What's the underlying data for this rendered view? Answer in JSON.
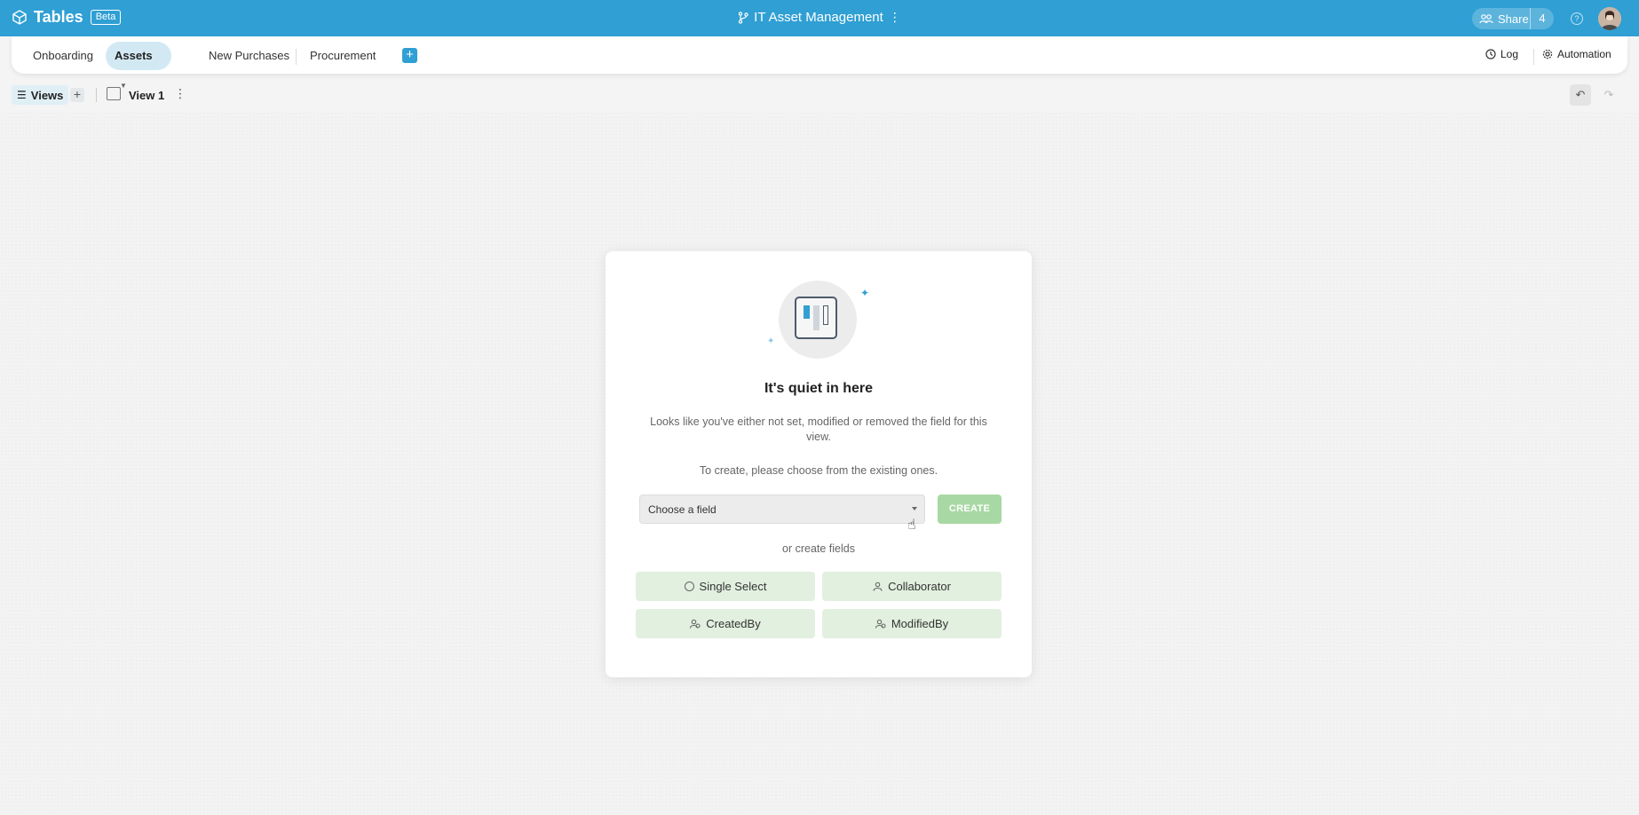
{
  "app": {
    "title": "Tables",
    "badge": "Beta"
  },
  "header": {
    "document_title": "IT Asset Management",
    "share_label": "Share",
    "share_count": "4"
  },
  "tabs": [
    {
      "label": "Onboarding"
    },
    {
      "label": "Assets",
      "active": true
    },
    {
      "label": "New Purchases"
    },
    {
      "label": "Procurement"
    }
  ],
  "tab_actions": {
    "log_label": "Log",
    "automation_label": "Automation"
  },
  "viewbar": {
    "views_label": "Views",
    "view_name": "View 1"
  },
  "empty_state": {
    "title": "It's quiet in here",
    "description": "Looks like you've either not set, modified or removed the field for this view.",
    "instruction": "To create, please choose from the existing ones.",
    "select_value": "Choose a field",
    "create_label": "CREATE",
    "or_text": "or create fields",
    "field_buttons": [
      {
        "label": "Single Select"
      },
      {
        "label": "Collaborator"
      },
      {
        "label": "CreatedBy"
      },
      {
        "label": "ModifiedBy"
      }
    ]
  },
  "colors": {
    "accent": "#2f9fd4",
    "create_button": "#a8d8a3",
    "field_button": "#e2f0df"
  }
}
